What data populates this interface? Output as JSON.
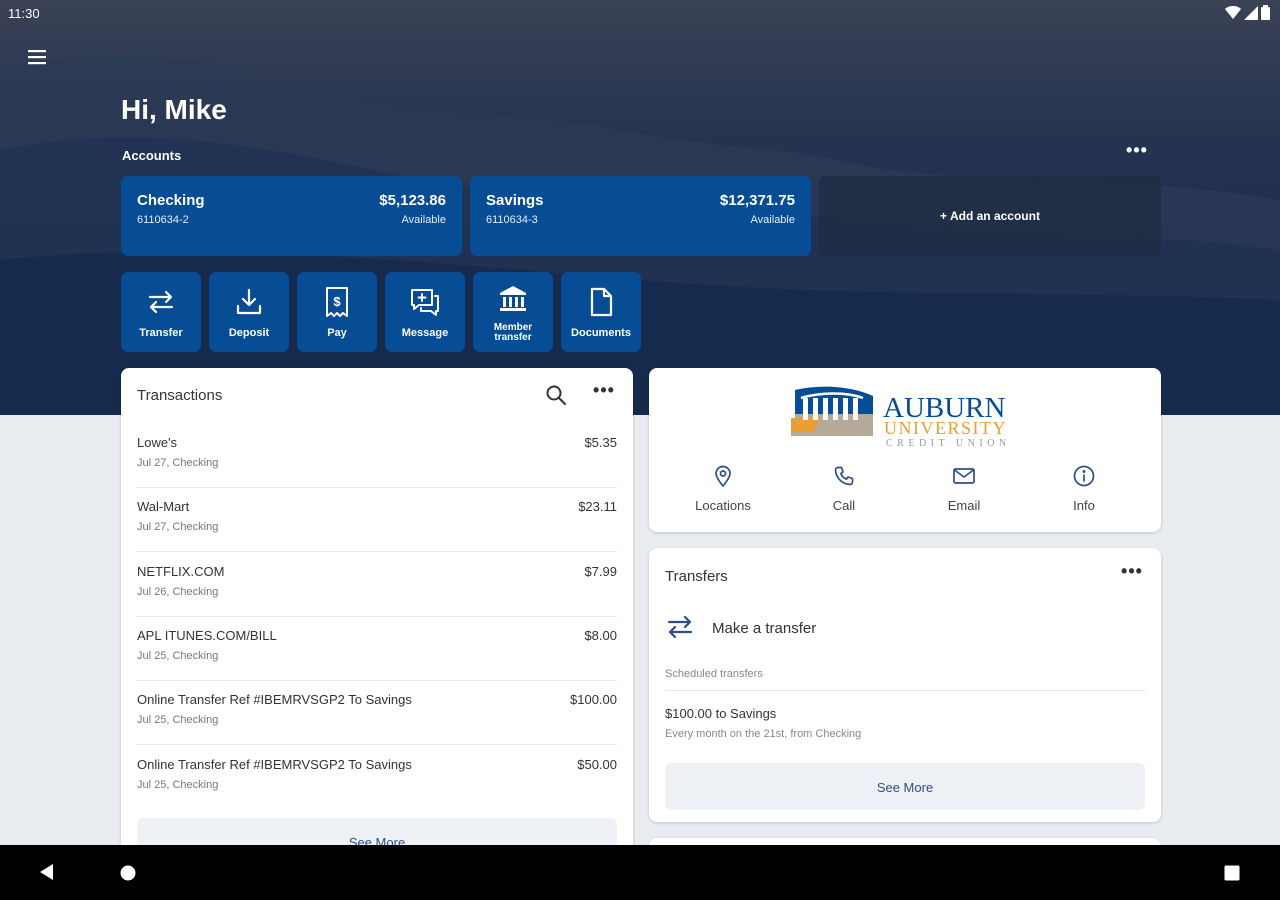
{
  "status_bar": {
    "time": "11:30"
  },
  "header": {
    "greeting": "Hi, Mike"
  },
  "accounts": {
    "label": "Accounts",
    "items": [
      {
        "name": "Checking",
        "number": "6110634-2",
        "balance": "$5,123.86",
        "status": "Available"
      },
      {
        "name": "Savings",
        "number": "6110634-3",
        "balance": "$12,371.75",
        "status": "Available"
      }
    ],
    "add_label": "+ Add an account"
  },
  "quick_actions": [
    {
      "label": "Transfer",
      "icon": "transfer-icon"
    },
    {
      "label": "Deposit",
      "icon": "deposit-icon"
    },
    {
      "label": "Pay",
      "icon": "pay-icon"
    },
    {
      "label": "Message",
      "icon": "message-icon"
    },
    {
      "label_line1": "Member",
      "label_line2": "transfer",
      "icon": "bank-icon"
    },
    {
      "label": "Documents",
      "icon": "document-icon"
    }
  ],
  "transactions": {
    "title": "Transactions",
    "rows": [
      {
        "desc": "Lowe's",
        "meta": "Jul 27, Checking",
        "amount": "$5.35"
      },
      {
        "desc": "Wal-Mart",
        "meta": "Jul 27, Checking",
        "amount": "$23.11"
      },
      {
        "desc": "NETFLIX.COM",
        "meta": "Jul 26, Checking",
        "amount": "$7.99"
      },
      {
        "desc": "APL ITUNES.COM/BILL",
        "meta": "Jul 25, Checking",
        "amount": "$8.00"
      },
      {
        "desc": "Online Transfer Ref #IBEMRVSGP2 To Savings",
        "meta": "Jul 25, Checking",
        "amount": "$100.00"
      },
      {
        "desc": "Online Transfer Ref #IBEMRVSGP2 To Savings",
        "meta": "Jul 25, Checking",
        "amount": "$50.00"
      }
    ],
    "see_more": "See More"
  },
  "brand": {
    "name_line1": "AUBURN",
    "name_line2": "UNIVERSITY",
    "name_line3": "CREDIT UNION",
    "actions": [
      {
        "label": "Locations",
        "icon": "location-pin-icon"
      },
      {
        "label": "Call",
        "icon": "phone-icon"
      },
      {
        "label": "Email",
        "icon": "email-icon"
      },
      {
        "label": "Info",
        "icon": "info-icon"
      }
    ]
  },
  "transfers": {
    "title": "Transfers",
    "make_label": "Make a transfer",
    "scheduled_label": "Scheduled transfers",
    "scheduled": [
      {
        "title": "$100.00 to Savings",
        "subtitle": "Every month on the 21st, from Checking"
      }
    ],
    "see_more": "See More"
  },
  "colors": {
    "primary": "#064d96",
    "link": "#2c4e86",
    "hero_dark": "#12284a",
    "background": "#e9ecf1"
  }
}
